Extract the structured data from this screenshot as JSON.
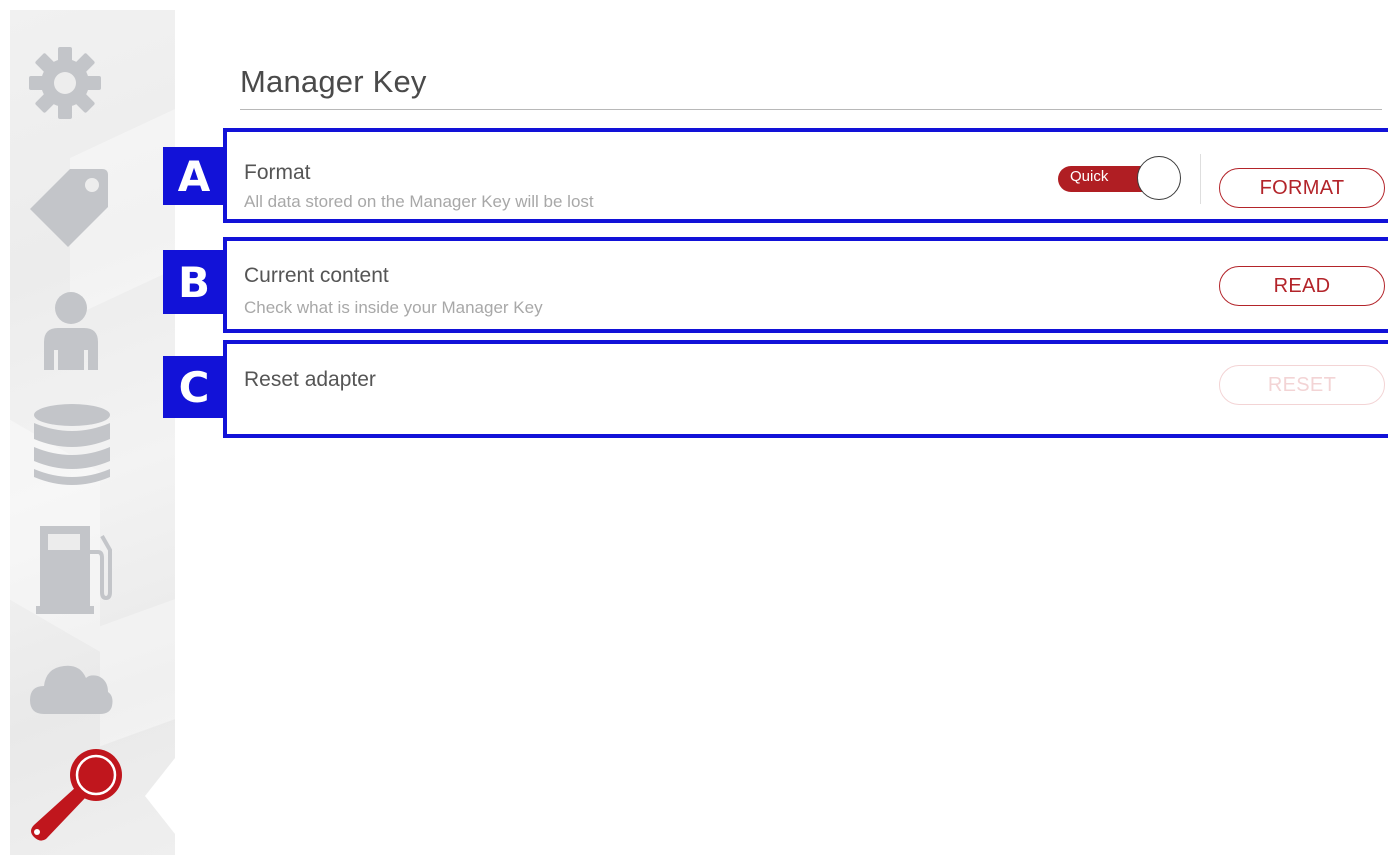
{
  "sidebar": {
    "items": [
      {
        "icon": "gear-icon"
      },
      {
        "icon": "tag-icon"
      },
      {
        "icon": "user-icon"
      },
      {
        "icon": "database-icon"
      },
      {
        "icon": "fuel-pump-icon"
      },
      {
        "icon": "cloud-icon"
      },
      {
        "icon": "manager-key-icon",
        "active": true
      }
    ]
  },
  "page": {
    "title": "Manager Key"
  },
  "rows": {
    "format": {
      "marker": "A",
      "title": "Format",
      "description": "All data stored on the Manager Key will be lost",
      "toggle_label": "Quick",
      "button_label": "FORMAT"
    },
    "content": {
      "marker": "B",
      "title": "Current content",
      "description": "Check what is inside your Manager Key",
      "button_label": "READ"
    },
    "reset": {
      "marker": "C",
      "title": "Reset adapter",
      "button_label": "RESET"
    }
  },
  "colors": {
    "accent": "#b3242a",
    "marker_blue": "#1212d8",
    "sidebar_icon": "#c3c5c9",
    "active_icon": "#c0161d"
  }
}
